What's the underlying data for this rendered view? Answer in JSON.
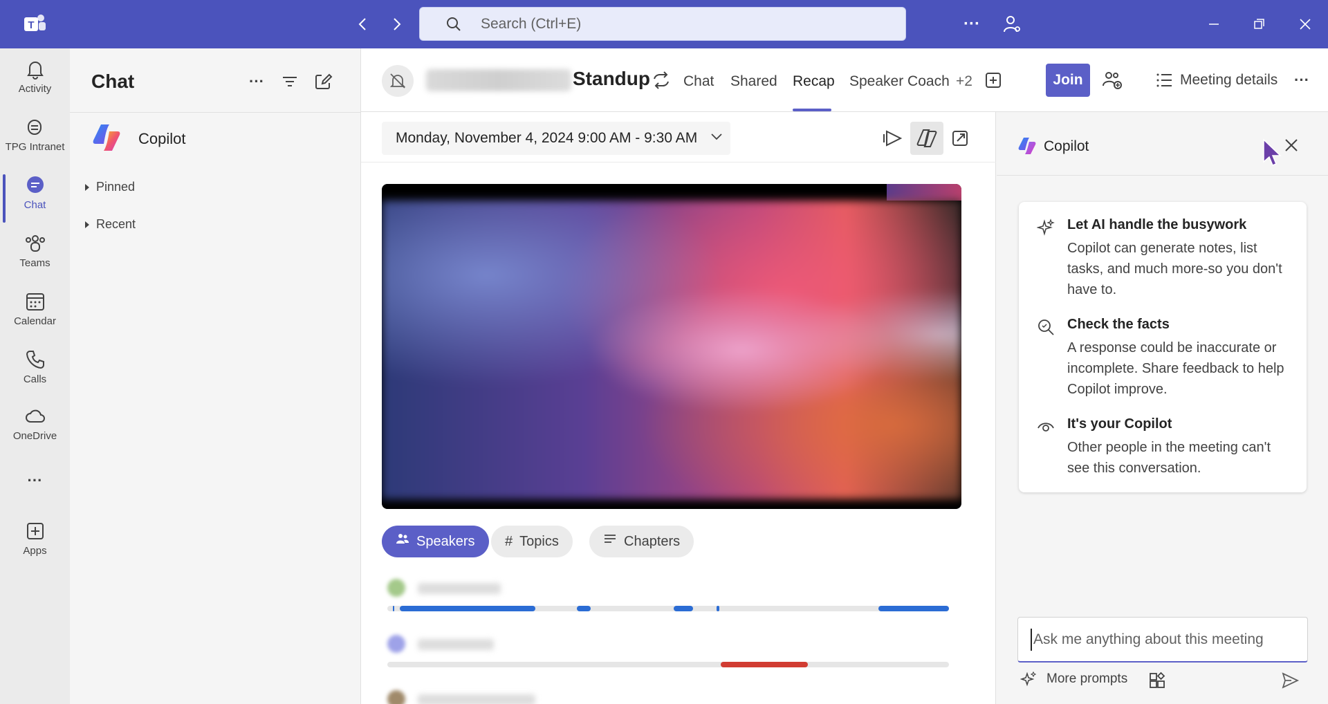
{
  "titlebar": {
    "search_placeholder": "Search (Ctrl+E)",
    "back_glyph": "‹",
    "forward_glyph": "›",
    "more_glyph": "···"
  },
  "rail": {
    "items": [
      {
        "label": "Activity",
        "icon": "bell-icon"
      },
      {
        "label": "TPG Intranet",
        "icon": "intranet-icon"
      },
      {
        "label": "Chat",
        "icon": "chat-icon",
        "active": true
      },
      {
        "label": "Teams",
        "icon": "teams-icon"
      },
      {
        "label": "Calendar",
        "icon": "calendar-icon"
      },
      {
        "label": "Calls",
        "icon": "phone-icon"
      },
      {
        "label": "OneDrive",
        "icon": "cloud-icon"
      },
      {
        "label": "Apps",
        "icon": "apps-icon"
      }
    ],
    "more_glyph": "···"
  },
  "chat": {
    "title": "Chat",
    "copilot_label": "Copilot",
    "sections": [
      "Pinned",
      "Recent"
    ]
  },
  "meeting": {
    "title": "Standup",
    "tabs": [
      "Chat",
      "Shared",
      "Recap",
      "Speaker Coach",
      "+2"
    ],
    "active_tab": "Recap",
    "join_label": "Join",
    "details_label": "Meeting details"
  },
  "recap": {
    "date_range": "Monday, November 4, 2024 9:00 AM - 9:30 AM",
    "pills": [
      {
        "label": "Speakers",
        "icon": "people-icon",
        "active": true
      },
      {
        "label": "Topics",
        "icon": "hashtag-icon",
        "active": false
      },
      {
        "label": "Chapters",
        "icon": "list-icon",
        "active": false
      }
    ],
    "speakers": [
      {
        "avatar_color": "#a4c98a",
        "bar_color": "#2b6cd4"
      },
      {
        "avatar_color": "#9ea2e8",
        "bar_color": "#d13c32"
      }
    ]
  },
  "copilot": {
    "title": "Copilot",
    "items": [
      {
        "heading": "Let AI handle the busywork",
        "body": "Copilot can generate notes, list tasks, and much more-so you don't have to.",
        "icon": "sparkle-icon"
      },
      {
        "heading": "Check the facts",
        "body": "A response could be inaccurate or incomplete. Share feedback to help Copilot improve.",
        "icon": "magnifier-icon"
      },
      {
        "heading": "It's your Copilot",
        "body": "Other people in the meeting can't see this conversation.",
        "icon": "eye-icon"
      }
    ],
    "ask_placeholder": "Ask me anything about this meeting",
    "more_prompts_label": "More prompts"
  },
  "colors": {
    "brand": "#4b53bc",
    "accent": "#5b5fc7"
  }
}
